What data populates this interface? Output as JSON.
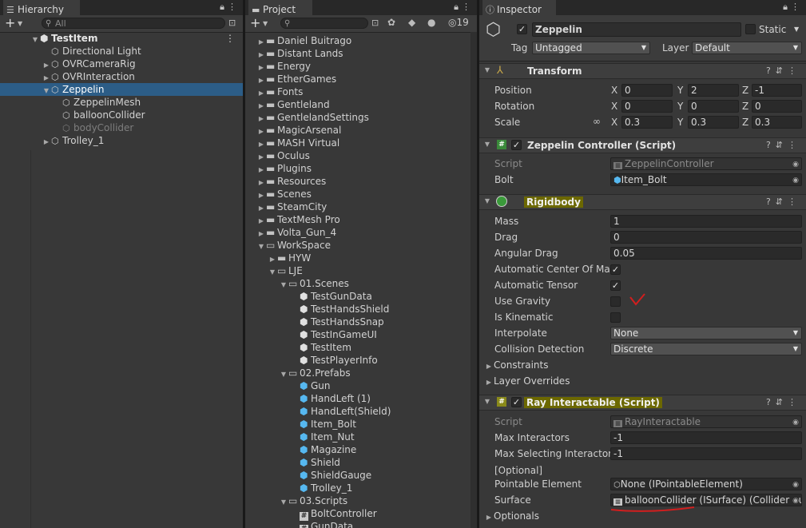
{
  "hierarchy": {
    "tab_label": "Hierarchy",
    "search_placeholder": "All",
    "scene_name": "TestItem",
    "items": [
      {
        "label": "Directional Light",
        "depth": 1,
        "expand": false
      },
      {
        "label": "OVRCameraRig",
        "depth": 1,
        "expand": true
      },
      {
        "label": "OVRInteraction",
        "depth": 1,
        "expand": true
      },
      {
        "label": "Zeppelin",
        "depth": 1,
        "expand": true,
        "open": true,
        "selected": true
      },
      {
        "label": "ZeppelinMesh",
        "depth": 2,
        "expand": false
      },
      {
        "label": "balloonCollider",
        "depth": 2,
        "expand": false
      },
      {
        "label": "bodyCollider",
        "depth": 2,
        "expand": false,
        "inactive": true
      },
      {
        "label": "Trolley_1",
        "depth": 1,
        "expand": true
      }
    ]
  },
  "project": {
    "tab_label": "Project",
    "hidden_count": "19",
    "items": [
      {
        "label": "Daniel Buitrago",
        "depth": 0,
        "type": "folder",
        "expand": "closed"
      },
      {
        "label": "Distant Lands",
        "depth": 0,
        "type": "folder",
        "expand": "closed"
      },
      {
        "label": "Energy",
        "depth": 0,
        "type": "folder",
        "expand": "closed"
      },
      {
        "label": "EtherGames",
        "depth": 0,
        "type": "folder",
        "expand": "closed"
      },
      {
        "label": "Fonts",
        "depth": 0,
        "type": "folder",
        "expand": "closed"
      },
      {
        "label": "Gentleland",
        "depth": 0,
        "type": "folder",
        "expand": "closed"
      },
      {
        "label": "GentlelandSettings",
        "depth": 0,
        "type": "folder",
        "expand": "closed"
      },
      {
        "label": "MagicArsenal",
        "depth": 0,
        "type": "folder",
        "expand": "closed"
      },
      {
        "label": "MASH Virtual",
        "depth": 0,
        "type": "folder",
        "expand": "closed"
      },
      {
        "label": "Oculus",
        "depth": 0,
        "type": "folder",
        "expand": "closed"
      },
      {
        "label": "Plugins",
        "depth": 0,
        "type": "folder",
        "expand": "closed"
      },
      {
        "label": "Resources",
        "depth": 0,
        "type": "folder",
        "expand": "closed"
      },
      {
        "label": "Scenes",
        "depth": 0,
        "type": "folder",
        "expand": "closed"
      },
      {
        "label": "SteamCity",
        "depth": 0,
        "type": "folder",
        "expand": "closed"
      },
      {
        "label": "TextMesh Pro",
        "depth": 0,
        "type": "folder",
        "expand": "closed"
      },
      {
        "label": "Volta_Gun_4",
        "depth": 0,
        "type": "folder",
        "expand": "closed"
      },
      {
        "label": "WorkSpace",
        "depth": 0,
        "type": "folder",
        "expand": "open"
      },
      {
        "label": "HYW",
        "depth": 1,
        "type": "folder",
        "expand": "closed"
      },
      {
        "label": "LJE",
        "depth": 1,
        "type": "folder",
        "expand": "open"
      },
      {
        "label": "01.Scenes",
        "depth": 2,
        "type": "folder",
        "expand": "open"
      },
      {
        "label": "TestGunData",
        "depth": 3,
        "type": "scene",
        "expand": "none"
      },
      {
        "label": "TestHandsShield",
        "depth": 3,
        "type": "scene",
        "expand": "none"
      },
      {
        "label": "TestHandsSnap",
        "depth": 3,
        "type": "scene",
        "expand": "none"
      },
      {
        "label": "TestInGameUI",
        "depth": 3,
        "type": "scene",
        "expand": "none"
      },
      {
        "label": "TestItem",
        "depth": 3,
        "type": "scene",
        "expand": "none"
      },
      {
        "label": "TestPlayerInfo",
        "depth": 3,
        "type": "scene",
        "expand": "none"
      },
      {
        "label": "02.Prefabs",
        "depth": 2,
        "type": "folder",
        "expand": "open"
      },
      {
        "label": "Gun",
        "depth": 3,
        "type": "prefab",
        "expand": "none"
      },
      {
        "label": "HandLeft (1)",
        "depth": 3,
        "type": "prefab",
        "expand": "none"
      },
      {
        "label": "HandLeft(Shield)",
        "depth": 3,
        "type": "prefab",
        "expand": "none"
      },
      {
        "label": "Item_Bolt",
        "depth": 3,
        "type": "prefab",
        "expand": "none"
      },
      {
        "label": "Item_Nut",
        "depth": 3,
        "type": "prefab",
        "expand": "none"
      },
      {
        "label": "Magazine",
        "depth": 3,
        "type": "prefab",
        "expand": "none"
      },
      {
        "label": "Shield",
        "depth": 3,
        "type": "prefab",
        "expand": "none"
      },
      {
        "label": "ShieldGauge",
        "depth": 3,
        "type": "prefab",
        "expand": "none"
      },
      {
        "label": "Trolley_1",
        "depth": 3,
        "type": "prefab",
        "expand": "none"
      },
      {
        "label": "03.Scripts",
        "depth": 2,
        "type": "folder",
        "expand": "open"
      },
      {
        "label": "BoltController",
        "depth": 3,
        "type": "script",
        "expand": "none"
      },
      {
        "label": "GunData",
        "depth": 3,
        "type": "script",
        "expand": "none"
      }
    ]
  },
  "inspector": {
    "tab_label": "Inspector",
    "object_name": "Zeppelin",
    "static_label": "Static",
    "tag_label": "Tag",
    "tag_value": "Untagged",
    "layer_label": "Layer",
    "layer_value": "Default",
    "transform": {
      "title": "Transform",
      "position_label": "Position",
      "rotation_label": "Rotation",
      "scale_label": "Scale",
      "position": {
        "x": "0",
        "y": "2",
        "z": "-1"
      },
      "rotation": {
        "x": "0",
        "y": "0",
        "z": "0"
      },
      "scale": {
        "x": "0.3",
        "y": "0.3",
        "z": "0.3"
      }
    },
    "zeppelin_controller": {
      "title": "Zeppelin Controller (Script)",
      "script_label": "Script",
      "script_value": "ZeppelinController",
      "bolt_label": "Bolt",
      "bolt_value": "Item_Bolt"
    },
    "rigidbody": {
      "title": "Rigidbody",
      "mass_label": "Mass",
      "mass": "1",
      "drag_label": "Drag",
      "drag": "0",
      "angular_drag_label": "Angular Drag",
      "angular_drag": "0.05",
      "auto_com_label": "Automatic Center Of Mass",
      "auto_tensor_label": "Automatic Tensor",
      "use_gravity_label": "Use Gravity",
      "is_kinematic_label": "Is Kinematic",
      "interpolate_label": "Interpolate",
      "interpolate": "None",
      "collision_label": "Collision Detection",
      "collision": "Discrete",
      "constraints_label": "Constraints",
      "layer_overrides_label": "Layer Overrides",
      "checks": {
        "auto_com": true,
        "auto_tensor": true,
        "use_gravity": false,
        "is_kinematic": false
      }
    },
    "ray_interactable": {
      "title": "Ray Interactable (Script)",
      "script_label": "Script",
      "script_value": "RayInteractable",
      "max_interactors_label": "Max Interactors",
      "max_interactors": "-1",
      "max_selecting_label": "Max Selecting Interactors",
      "max_selecting": "-1",
      "optional_label": "[Optional]",
      "pointable_label": "Pointable Element",
      "pointable_value": "None (IPointableElement)",
      "surface_label": "Surface",
      "surface_value": "balloonCollider (ISurface) (Collider Surface)",
      "optionals_label": "Optionals"
    }
  },
  "colors": {
    "selection": "#2c5d87",
    "annotation": "#d11e1e",
    "highlight": "#6c6800",
    "prefab": "#56b8f0"
  }
}
